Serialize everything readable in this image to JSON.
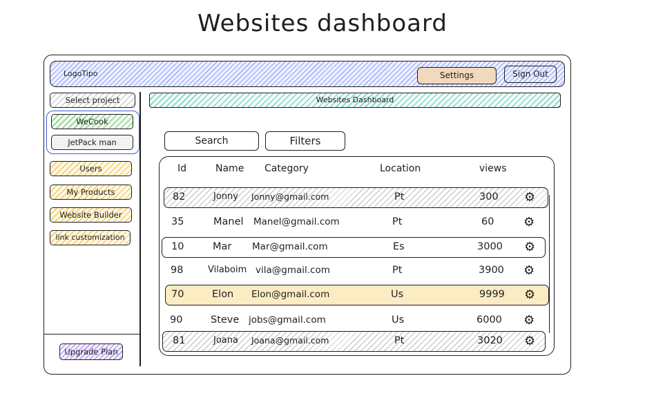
{
  "page": {
    "title": "Websites dashboard"
  },
  "header": {
    "logo": "LogoTipo",
    "settings_label": "Settings",
    "signout_label": "Sign Out"
  },
  "sidebar": {
    "select_project_label": "Select project",
    "projects": [
      {
        "label": "WeCook"
      },
      {
        "label": "JetPack man"
      }
    ],
    "items": [
      {
        "label": "Users"
      },
      {
        "label": "My Products"
      },
      {
        "label": "Website Builder"
      },
      {
        "label": "link customization"
      }
    ],
    "upgrade_label": "Upgrade Plan"
  },
  "main": {
    "banner": "Websites Dashboard",
    "search_label": "Search",
    "filters_label": "Filters",
    "columns": [
      "Id",
      "Name",
      "Category",
      "Location",
      "views"
    ],
    "rows": [
      {
        "id": "82",
        "name": "Jonny",
        "category": "Jonny@gmail.com",
        "location": "Pt",
        "views": "300",
        "icon": "gear-icon"
      },
      {
        "id": "35",
        "name": "Manel",
        "category": "Manel@gmail.com",
        "location": "Pt",
        "views": "60",
        "icon": "gear-icon"
      },
      {
        "id": "10",
        "name": "Mar",
        "category": "Mar@gmail.com",
        "location": "Es",
        "views": "3000",
        "icon": "gear-icon"
      },
      {
        "id": "98",
        "name": "Vilaboim",
        "category": "vila@gmail.com",
        "location": "Pt",
        "views": "3900",
        "icon": "gear-icon"
      },
      {
        "id": "70",
        "name": "Elon",
        "category": "Elon@gmail.com",
        "location": "Us",
        "views": "9999",
        "icon": "gear-icon"
      },
      {
        "id": "90",
        "name": "Steve",
        "category": "jobs@gmail.com",
        "location": "Us",
        "views": "6000",
        "icon": "gear-icon"
      },
      {
        "id": "81",
        "name": "Joana",
        "category": "Joana@gmail.com",
        "location": "Pt",
        "views": "3020",
        "icon": "gear-icon"
      }
    ]
  },
  "colors": {
    "header_hatch": "#a5b4fc",
    "settings": "#f1d9bd",
    "highlight_row": "#fbecc4",
    "project_active": "#8fd18f",
    "upgrade": "#b59cf0"
  }
}
